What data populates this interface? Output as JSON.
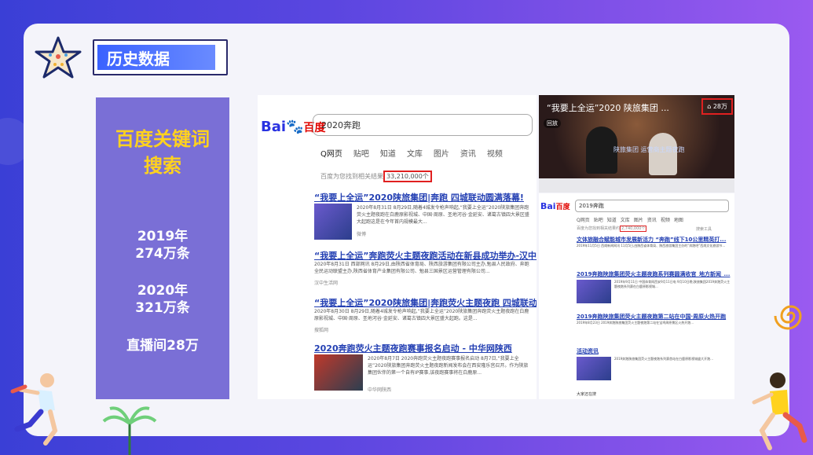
{
  "header": {
    "title": "历史数据"
  },
  "left_panel": {
    "keyword_line1": "百度关键词",
    "keyword_line2": "搜索",
    "y2019_line1": "2019年",
    "y2019_line2": "274万条",
    "y2020_line1": "2020年",
    "y2020_line2": "321万条",
    "live": "直播间28万"
  },
  "search1": {
    "logo_bai": "Bai",
    "logo_du": "百度",
    "query": "2020奔跑",
    "tabs": [
      "Q网页",
      "贴吧",
      "知道",
      "文库",
      "图片",
      "资讯",
      "视频"
    ],
    "result_count_prefix": "百度为您找到相关结果",
    "result_count": "33,210,000个",
    "results": [
      {
        "title": "“我要上全运”2020陕旅集团|奔跑 四城联动圆满落幕!",
        "snippet": "2020年8月31日 8月29日,随着4城发令枪声响起,“我要上全运”2020陕旅集团奔跑荧火主题夜跑在白鹿原影视城、中国·周原、圣地河谷·金延安、诸葛古镇四大景区盛大起跑这是在今年首内规模最大...",
        "source": "微博"
      },
      {
        "title": "“我要上全运”奔跑荧火主题夜跑活动在新县成功举办-汉中...",
        "snippet": "2020年8月31日 西部网讯 8月29日,由陕西省体育局、陕西旅游集团有限公司主办,勉县人民政府、奔跑全民运动联盟主办,陕西省体育产业集团有限公司、勉县三国景区运营管理有限公司...",
        "source": "汉中生活网"
      },
      {
        "title": "“我要上全运”2020陕旅集团|奔跑荧火主题夜跑 四城联动圆...",
        "snippet": "2020年8月30日 8月29日,随着4城发令枪声响起,“我要上全运”2020陕旅集团奔跑荧火主题夜跑在白鹿原影视城、中国·周原、圣地河谷·金延安、诸葛古镇四大景区盛大起跑。这是...",
        "source": "搜狐网"
      },
      {
        "title": "2020奔跑荧火主题夜跑赛事报名启动 - 中华网陕西",
        "snippet": "2020年8月7日 2020奔跑荧火主题夜跑赛事报名启动 8月7日,“我要上全运”2020陕旅集团奔跑荧火主题夜跑新闻发布会在西安隆乐宫召开。作为陕旅集团伙伴的第一个自有IP赛事,该夜跑赛事将在白鹿原...",
        "source": "中华网陕西"
      }
    ]
  },
  "live": {
    "title": "“我要上全运”2020 陕旅集团 ...",
    "viewers": "28万",
    "replay_badge": "回放",
    "banner": "陕旅集团 运营商主题夜跑"
  },
  "search2": {
    "logo_bai": "Bai",
    "logo_du": "百度",
    "query": "2019奔跑",
    "tabs": [
      "Q网页",
      "贴吧",
      "知道",
      "文库",
      "图片",
      "资讯",
      "视频",
      "地图"
    ],
    "tool": "搜索工具",
    "result_count_prefix": "百度为您找到相关结果约",
    "result_count": "2,740,000个",
    "results": [
      {
        "title": "文体旅融合赋能城市发展新活力 “奔跑”线下10公里精英打...",
        "snippet": "2019年11月5日 西咸新闻网讯 11月5日,由陕西省体育局、陕西旅游集团主办的“奔跑吧”西咸文化旅游节..."
      },
      {
        "title": "2019奔跑陕旅集团荧火主题夜跑系列赛圆满收官_地方新闻_...",
        "snippet": "2019年9月11日 中国体育网西安9月11日电 9月10日晚,陕旅集团2019奔跑荧火主题夜跑系列赛在白鹿原影视城..."
      },
      {
        "title": "2019奔跑陕旅集团荧火主题夜跑第二站在中国·周原火热开跑",
        "snippet": "2019年8月23日 2019奔跑陕旅集团荧火主题夜跑第二站在宝鸡周原景区火热开跑..."
      },
      {
        "title": "活动资讯",
        "snippet": "2019奔跑陕旅集团荧火主题夜跑系列赛首站在白鹿原影视城盛大开跑..."
      }
    ],
    "footer": "大家还在搜"
  }
}
